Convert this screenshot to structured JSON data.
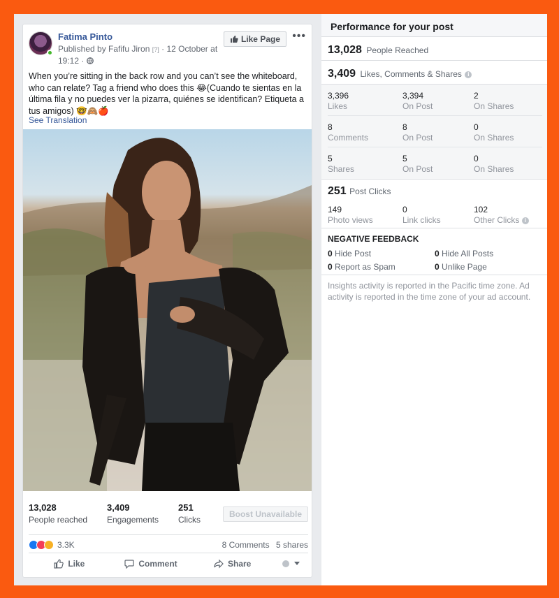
{
  "post": {
    "author": "Fatima Pinto",
    "published_by": "Published by Fafifu Jiron",
    "help_mark": "[?]",
    "date": "· 12 October at 19:12 ·",
    "like_page_label": "Like Page",
    "more_label": "•••",
    "caption": "When you’re sitting in the back row and you can’t see the whiteboard, who can relate? Tag a friend who does this 😂(Cuando te sientas en la última fila y no puedes ver la pizarra, quiénes se identifican? Etiqueta a tus amigos) 🤓🙈🍎",
    "see_translation": "See Translation",
    "stats": [
      {
        "value": "13,028",
        "label": "People reached"
      },
      {
        "value": "3,409",
        "label": "Engagements"
      },
      {
        "value": "251",
        "label": "Clicks"
      }
    ],
    "boost_label": "Boost Unavailable",
    "reactions_count": "3.3K",
    "comments_label": "8 Comments",
    "shares_label": "5 shares",
    "actions": {
      "like": "Like",
      "comment": "Comment",
      "share": "Share"
    }
  },
  "insights": {
    "title": "Performance for your post",
    "people_reached": {
      "value": "13,028",
      "label": "People Reached"
    },
    "engagement": {
      "value": "3,409",
      "label": "Likes, Comments & Shares"
    },
    "grid": [
      [
        {
          "v": "3,396",
          "k": "Likes"
        },
        {
          "v": "3,394",
          "k": "On Post"
        },
        {
          "v": "2",
          "k": "On Shares"
        }
      ],
      [
        {
          "v": "8",
          "k": "Comments"
        },
        {
          "v": "8",
          "k": "On Post"
        },
        {
          "v": "0",
          "k": "On Shares"
        }
      ],
      [
        {
          "v": "5",
          "k": "Shares"
        },
        {
          "v": "5",
          "k": "On Post"
        },
        {
          "v": "0",
          "k": "On Shares"
        }
      ]
    ],
    "post_clicks": {
      "value": "251",
      "label": "Post Clicks"
    },
    "clicks": [
      {
        "v": "149",
        "k": "Photo views"
      },
      {
        "v": "0",
        "k": "Link clicks"
      },
      {
        "v": "102",
        "k": "Other Clicks"
      }
    ],
    "negative_feedback": {
      "title": "NEGATIVE FEEDBACK",
      "items": [
        {
          "v": "0",
          "k": "Hide Post"
        },
        {
          "v": "0",
          "k": "Hide All Posts"
        },
        {
          "v": "0",
          "k": "Report as Spam"
        },
        {
          "v": "0",
          "k": "Unlike Page"
        }
      ]
    },
    "note": "Insights activity is reported in the Pacific time zone. Ad activity is reported in the time zone of your ad account."
  },
  "colors": {
    "accent": "#365899",
    "frame": "#fa5a10",
    "page_bg": "#e9ebee"
  }
}
